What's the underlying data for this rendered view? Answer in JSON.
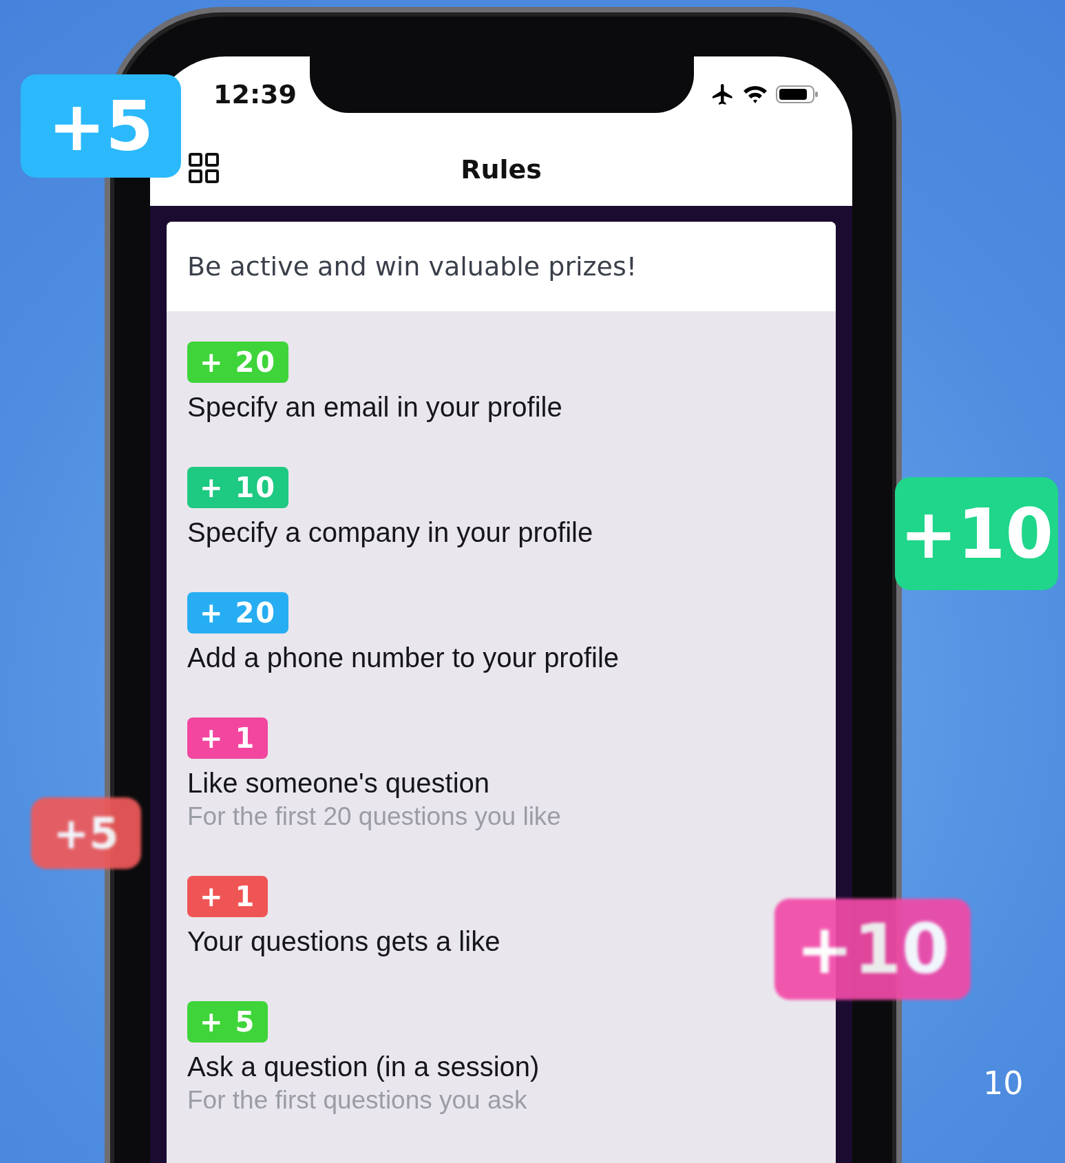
{
  "status_bar": {
    "time": "12:39"
  },
  "nav_bar": {
    "title": "Rules"
  },
  "card": {
    "intro": "Be active and win valuable prizes!",
    "rules": [
      {
        "points": "+ 20",
        "color": "#3fd43a",
        "title": "Specify an email in your profile"
      },
      {
        "points": "+ 10",
        "color": "#1ec981",
        "title": "Specify a company in your profile"
      },
      {
        "points": "+ 20",
        "color": "#27adf2",
        "title": "Add a phone number to your profile"
      },
      {
        "points": "+ 1",
        "color": "#f2469f",
        "title": "Like someone's question",
        "note": "For the first 20 questions you like"
      },
      {
        "points": "+ 1",
        "color": "#f05555",
        "title": "Your questions gets a like"
      },
      {
        "points": "+ 5",
        "color": "#3fd43a",
        "title": "Ask a question (in a session)",
        "note": "For the first questions you ask"
      }
    ]
  },
  "stickers": [
    {
      "text": "+5",
      "color": "#2cb9fb",
      "blurred": false
    },
    {
      "text": "+10",
      "color": "#1fd68a",
      "blurred": false
    },
    {
      "text": "+5",
      "color": "#f05a5a",
      "blurred": true
    },
    {
      "text": "+10",
      "color": "#f24aa8",
      "blurred": true
    }
  ],
  "page_number": "10"
}
